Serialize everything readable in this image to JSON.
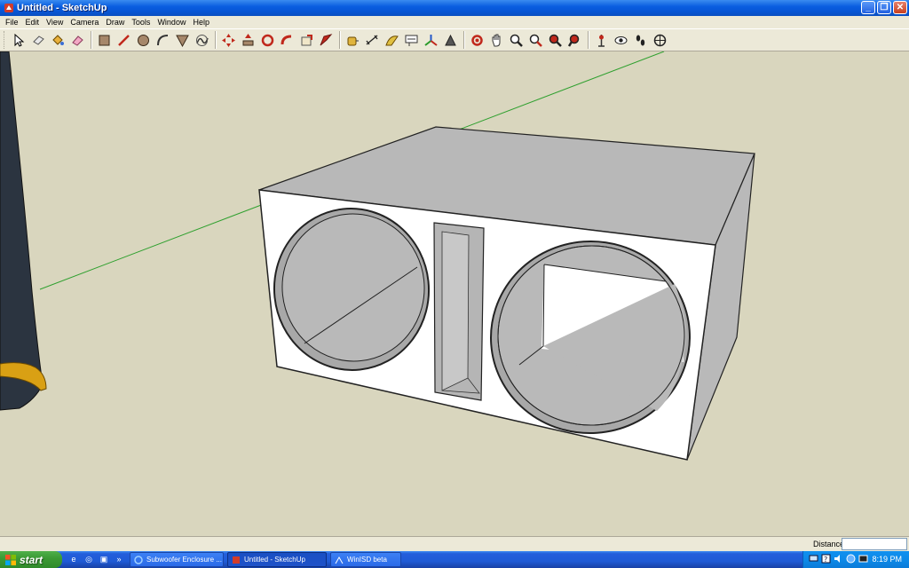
{
  "window": {
    "title": "Untitled - SketchUp",
    "buttons": [
      "minimize",
      "maximize",
      "close"
    ]
  },
  "menu": [
    "File",
    "Edit",
    "View",
    "Camera",
    "Draw",
    "Tools",
    "Window",
    "Help"
  ],
  "toolbar": {
    "tools": [
      {
        "icon": "select-icon"
      },
      {
        "icon": "eraser-icon"
      },
      {
        "icon": "paint-bucket-icon"
      },
      {
        "icon": "erase-icon"
      },
      {
        "icon": "rectangle-icon"
      },
      {
        "icon": "line-icon"
      },
      {
        "icon": "circle-icon"
      },
      {
        "icon": "arc-icon"
      },
      {
        "icon": "polygon-icon"
      },
      {
        "icon": "freehand-icon"
      },
      {
        "icon": "move-icon"
      },
      {
        "icon": "push-pull-icon"
      },
      {
        "icon": "rotate-icon"
      },
      {
        "icon": "follow-me-icon"
      },
      {
        "icon": "scale-icon"
      },
      {
        "icon": "offset-icon"
      },
      {
        "icon": "tape-measure-icon"
      },
      {
        "icon": "dimension-icon"
      },
      {
        "icon": "protractor-icon"
      },
      {
        "icon": "text-icon"
      },
      {
        "icon": "axes-icon"
      },
      {
        "icon": "3d-text-icon"
      },
      {
        "icon": "orbit-icon"
      },
      {
        "icon": "pan-icon"
      },
      {
        "icon": "zoom-icon"
      },
      {
        "icon": "zoom-window-icon"
      },
      {
        "icon": "zoom-previous-icon"
      },
      {
        "icon": "zoom-extents-icon"
      },
      {
        "icon": "position-camera-icon"
      },
      {
        "icon": "look-around-icon"
      },
      {
        "icon": "walk-icon"
      },
      {
        "icon": "section-plane-icon"
      }
    ]
  },
  "status": {
    "vcb_label": "Distance",
    "vcb_value": ""
  },
  "taskbar": {
    "start_label": "start",
    "tasks": [
      {
        "label": "Subwoofer Enclosure ...",
        "icon": "ie-icon",
        "active": false
      },
      {
        "label": "Untitled - SketchUp",
        "icon": "sketchup-icon",
        "active": true
      },
      {
        "label": "WinISD beta",
        "icon": "winisd-icon",
        "active": false
      }
    ],
    "clock": "8:19 PM"
  },
  "colors": {
    "sky_ground": "#d9d6be",
    "box_face": "#ffffff",
    "box_shade": "#c0c0c0",
    "axis_green": "#2fa02f"
  }
}
